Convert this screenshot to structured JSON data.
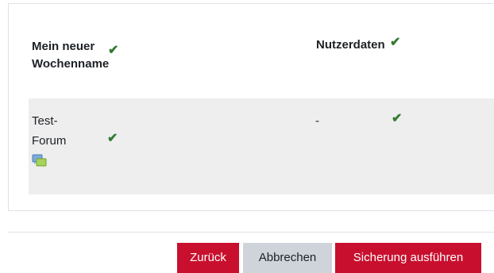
{
  "table": {
    "header_section": "Mein neuer Wochenname",
    "header_userdata": "Nutzerdaten",
    "header_section_check": "✔",
    "header_userdata_check": "✔",
    "rows": [
      {
        "activity": "Test-Forum",
        "activity_icon": "forum-icon",
        "activity_check": "✔",
        "userdata_value": "-",
        "userdata_check": "✔"
      }
    ]
  },
  "buttons": {
    "back": "Zurück",
    "cancel": "Abbrechen",
    "perform": "Sicherung ausführen"
  },
  "colors": {
    "primary": "#c8102e",
    "secondary": "#ced4da",
    "check": "#357a32",
    "row_bg": "#eeeeee"
  }
}
